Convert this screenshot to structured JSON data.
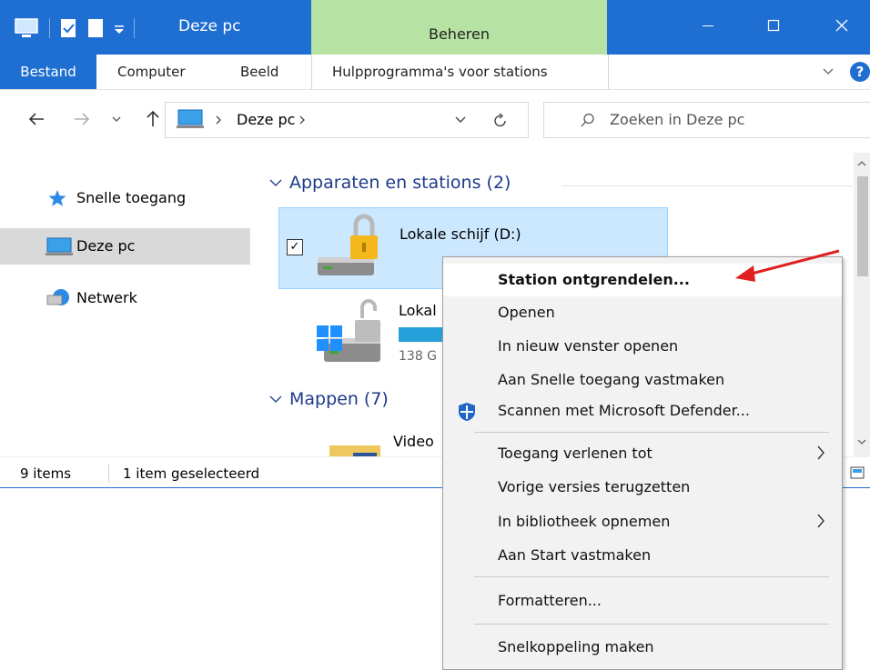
{
  "window": {
    "title": "Deze pc",
    "context_tab": "Beheren"
  },
  "ribbon": {
    "file": "Bestand",
    "tabs": [
      "Computer",
      "Beeld"
    ],
    "tool_tab": "Hulpprogramma's voor stations"
  },
  "address": {
    "location": "Deze pc",
    "search_placeholder": "Zoeken in Deze pc"
  },
  "sidebar": {
    "items": [
      {
        "label": "Snelle toegang"
      },
      {
        "label": "Deze pc"
      },
      {
        "label": "Netwerk"
      }
    ]
  },
  "content": {
    "group_devices": "Apparaten en stations (2)",
    "group_folders": "Mappen (7)",
    "drive_d": "Lokale schijf (D:)",
    "drive_c_partial": "Lokal",
    "drive_c_size_partial": "138 G",
    "folder_partial": "Video",
    "drive_c_usage": 0.55
  },
  "status": {
    "items": "9 items",
    "selected": "1 item geselecteerd"
  },
  "context_menu": {
    "items": [
      "Station ontgrendelen...",
      "Openen",
      "In nieuw venster openen",
      "Aan Snelle toegang vastmaken",
      "Scannen met Microsoft Defender...",
      "Toegang verlenen tot",
      "Vorige versies terugzetten",
      "In bibliotheek opnemen",
      "Aan Start vastmaken",
      "Formatteren...",
      "Snelkoppeling maken"
    ]
  },
  "colors": {
    "accent": "#1f6ed1",
    "context_tab": "#b6e3a3",
    "selection": "#cce8ff",
    "annotation_arrow": "#e02020"
  }
}
